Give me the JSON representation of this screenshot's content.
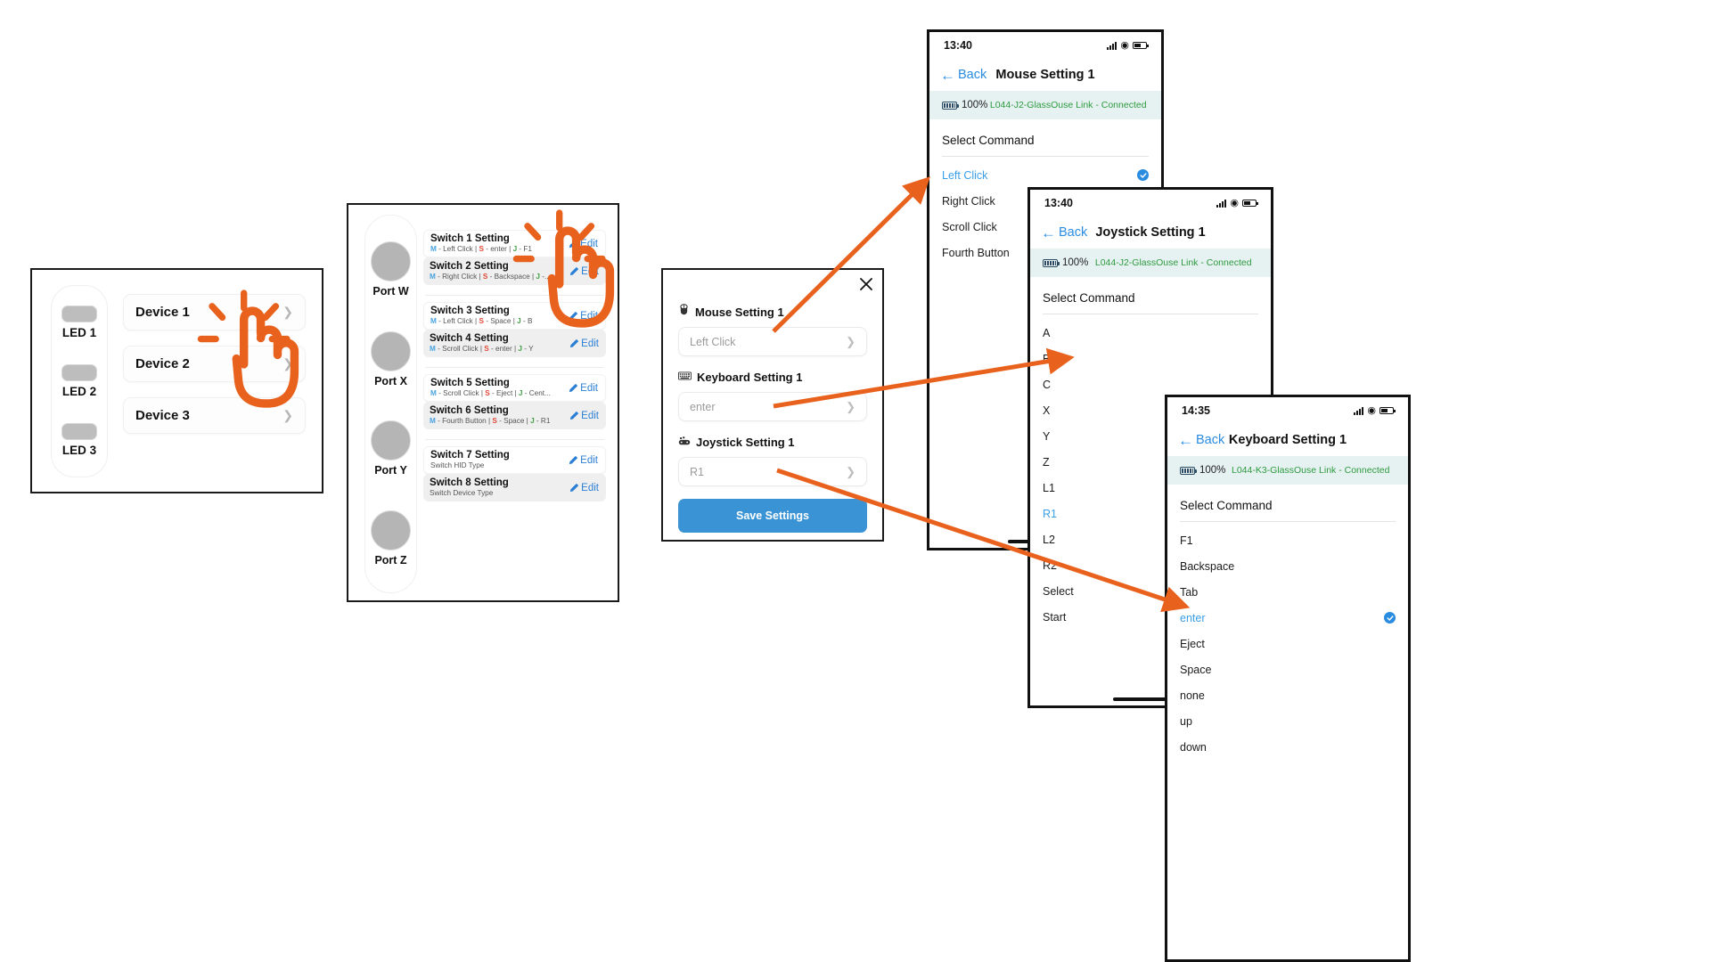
{
  "accent": {
    "orange": "#E8621E",
    "blue": "#2A8CE0",
    "green": "#2E9B3F",
    "red": "#E04A3A",
    "save_blue": "#3A93D4"
  },
  "device_panel": {
    "leds": [
      {
        "label": "LED 1"
      },
      {
        "label": "LED 2"
      },
      {
        "label": "LED 3"
      }
    ],
    "devices": [
      {
        "label": "Device 1",
        "chevron": "chevron-right-icon"
      },
      {
        "label": "Device 2",
        "chevron": "chevron-right-icon"
      },
      {
        "label": "Device 3",
        "chevron": "chevron-right-icon"
      }
    ]
  },
  "switch_panel": {
    "ports": [
      {
        "label": "Port W"
      },
      {
        "label": "Port X"
      },
      {
        "label": "Port Y"
      },
      {
        "label": "Port Z"
      }
    ],
    "edit_label": "Edit",
    "groups": [
      {
        "rows": [
          {
            "title": "Switch 1 Setting",
            "parts": [
              {
                "key": "M",
                "val": " - Left Click"
              },
              {
                "key": "S",
                "val": " - enter"
              },
              {
                "key": "J",
                "val": " - F1"
              }
            ],
            "style": "plain"
          },
          {
            "title": "Switch 2 Setting",
            "parts": [
              {
                "key": "M",
                "val": " - Right Click"
              },
              {
                "key": "S",
                "val": " - Backspace"
              },
              {
                "key": "J",
                "val": " -..."
              }
            ],
            "style": "alt"
          }
        ]
      },
      {
        "rows": [
          {
            "title": "Switch 3 Setting",
            "parts": [
              {
                "key": "M",
                "val": " - Left Click"
              },
              {
                "key": "S",
                "val": " - Space"
              },
              {
                "key": "J",
                "val": " - B"
              }
            ],
            "style": "plain"
          },
          {
            "title": "Switch 4 Setting",
            "parts": [
              {
                "key": "M",
                "val": " - Scroll Click"
              },
              {
                "key": "S",
                "val": " - enter"
              },
              {
                "key": "J",
                "val": " - Y"
              }
            ],
            "style": "alt"
          }
        ]
      },
      {
        "rows": [
          {
            "title": "Switch 5 Setting",
            "parts": [
              {
                "key": "M",
                "val": " - Scroll Click"
              },
              {
                "key": "S",
                "val": " - Eject"
              },
              {
                "key": "J",
                "val": " - Cent..."
              }
            ],
            "style": "plain"
          },
          {
            "title": "Switch 6 Setting",
            "parts": [
              {
                "key": "M",
                "val": " - Fourth Button"
              },
              {
                "key": "S",
                "val": " - Space"
              },
              {
                "key": "J",
                "val": " - R1"
              }
            ],
            "style": "alt"
          }
        ]
      },
      {
        "rows": [
          {
            "title": "Switch 7 Setting",
            "plainsub": "Switch HID Type",
            "style": "plain"
          },
          {
            "title": "Switch 8 Setting",
            "plainsub": "Switch Device Type",
            "style": "alt"
          }
        ]
      }
    ]
  },
  "modal": {
    "close": "close-icon",
    "fields": [
      {
        "icon": "mouse-icon",
        "label": "Mouse Setting 1",
        "value": "Left Click",
        "chevron": "chevron-right-icon"
      },
      {
        "icon": "keyboard-icon",
        "label": "Keyboard Setting 1",
        "value": "enter",
        "chevron": "chevron-right-icon"
      },
      {
        "icon": "joystick-icon",
        "label": "Joystick Setting 1",
        "value": "R1",
        "chevron": "chevron-right-icon"
      }
    ],
    "save_label": "Save Settings"
  },
  "phones": [
    {
      "id": "mouse",
      "time": "13:40",
      "back_label": "Back",
      "title": "Mouse Setting 1",
      "battery_pct": "100%",
      "device_name": "L044-J2-GlassOuse Link - Connected",
      "section_label": "Select Command",
      "items": [
        {
          "label": "Left Click",
          "selected": true,
          "check": true
        },
        {
          "label": "Right Click",
          "selected": false,
          "check": false
        },
        {
          "label": "Scroll Click",
          "selected": false,
          "check": false
        },
        {
          "label": "Fourth Button",
          "selected": false,
          "check": false
        }
      ]
    },
    {
      "id": "joystick",
      "time": "13:40",
      "back_label": "Back",
      "title": "Joystick Setting 1",
      "battery_pct": "100%",
      "device_name": "L044-J2-GlassOuse Link - Connected",
      "section_label": "Select Command",
      "items": [
        {
          "label": "A",
          "selected": false,
          "check": false
        },
        {
          "label": "B",
          "selected": false,
          "check": false
        },
        {
          "label": "C",
          "selected": false,
          "check": false
        },
        {
          "label": "X",
          "selected": false,
          "check": false
        },
        {
          "label": "Y",
          "selected": false,
          "check": false
        },
        {
          "label": "Z",
          "selected": false,
          "check": false
        },
        {
          "label": "L1",
          "selected": false,
          "check": false
        },
        {
          "label": "R1",
          "selected": true,
          "check": false
        },
        {
          "label": "L2",
          "selected": false,
          "check": false
        },
        {
          "label": "R2",
          "selected": false,
          "check": false
        },
        {
          "label": "Select",
          "selected": false,
          "check": false
        },
        {
          "label": "Start",
          "selected": false,
          "check": false
        }
      ]
    },
    {
      "id": "keyboard",
      "time": "14:35",
      "back_label": "Back",
      "title": "Keyboard Setting 1",
      "battery_pct": "100%",
      "device_name": "L044-K3-GlassOuse Link - Connected",
      "section_label": "Select Command",
      "items": [
        {
          "label": "F1",
          "selected": false,
          "check": false
        },
        {
          "label": "Backspace",
          "selected": false,
          "check": false
        },
        {
          "label": "Tab",
          "selected": false,
          "check": false
        },
        {
          "label": "enter",
          "selected": true,
          "check": true
        },
        {
          "label": "Eject",
          "selected": false,
          "check": false
        },
        {
          "label": "Space",
          "selected": false,
          "check": false
        },
        {
          "label": "none",
          "selected": false,
          "check": false
        },
        {
          "label": "up",
          "selected": false,
          "check": false
        },
        {
          "label": "down",
          "selected": false,
          "check": false
        }
      ]
    }
  ],
  "annotations": {
    "arrows": [
      {
        "name": "arrow-to-mouse-phone"
      },
      {
        "name": "arrow-to-joystick-phone"
      },
      {
        "name": "arrow-to-keyboard-phone"
      }
    ],
    "hands": [
      {
        "name": "tap-hand-device1"
      },
      {
        "name": "tap-hand-switch2"
      }
    ]
  }
}
